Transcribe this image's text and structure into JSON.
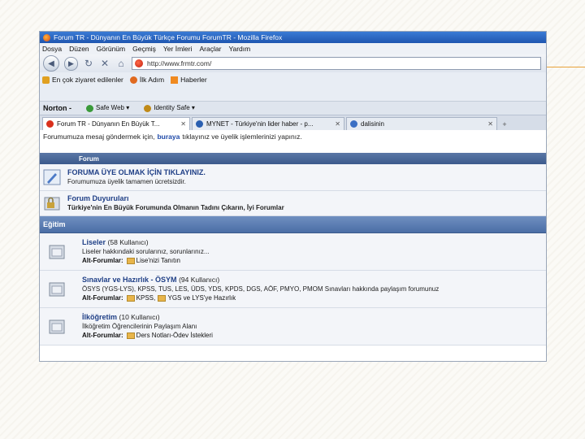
{
  "window_title": "Forum TR - Dünyanın En Büyük Türkçe Forumu ForumTR - Mozilla Firefox",
  "menu": [
    "Dosya",
    "Düzen",
    "Görünüm",
    "Geçmiş",
    "Yer İmleri",
    "Araçlar",
    "Yardım"
  ],
  "url": "http://www.frmtr.com/",
  "bookmarks": [
    "En çok ziyaret edilenler",
    "İlk Adım",
    "Haberler"
  ],
  "norton": {
    "brand": "Norton -",
    "safeweb": "Safe Web ▾",
    "identity": "Identity Safe ▾"
  },
  "tabs": [
    {
      "label": "Forum TR - Dünyanın En Büyük T...",
      "color": "#d9301c"
    },
    {
      "label": "MYNET - Türkiye'nin lider haber - p...",
      "color": "#2a5fb0"
    },
    {
      "label": "dalisinin",
      "color": "#3b6fc4"
    }
  ],
  "notice": {
    "before": "Forumumuza mesaj göndermek için,",
    "link": "buraya",
    "after": "tıklayınız ve üyelik işlemlerinizi yapınız."
  },
  "forum_header": "Forum",
  "register": {
    "title": "FORUMA ÜYE OLMAK İÇİN TIKLAYINIZ.",
    "desc": "Forumumuza üyelik tamamen ücretsizdir."
  },
  "announcements": {
    "title": "Forum Duyuruları",
    "desc": "Türkiye'nin En Büyük Forumunda Olmanın Tadını Çıkarın, İyi Forumlar"
  },
  "category": "Eğitim",
  "alt_label": "Alt-Forumlar:",
  "forums": [
    {
      "title": "Liseler",
      "count": "(58 Kullanıcı)",
      "desc": "Liseler hakkındaki sorularınız, sorunlarınız...",
      "sub": [
        "Lise'nizi Tanıtın"
      ]
    },
    {
      "title": "Sınavlar ve Hazırlık - ÖSYM",
      "count": "(94 Kullanıcı)",
      "desc": "ÖSYS (YGS-LYS), KPSS, TUS, LES, ÜDS, YDS, KPDS, DGS, AÖF, PMYO, PMOM Sınavları hakkında paylaşım forumunuz",
      "sub": [
        "KPSS,",
        "YGS ve LYS'ye Hazırlık"
      ]
    },
    {
      "title": "İlköğretim",
      "count": "(10 Kullanıcı)",
      "desc": "İlköğretim Öğrencilerinin Paylaşım Alanı",
      "sub": [
        "Ders Notları-Ödev İstekleri"
      ]
    }
  ]
}
